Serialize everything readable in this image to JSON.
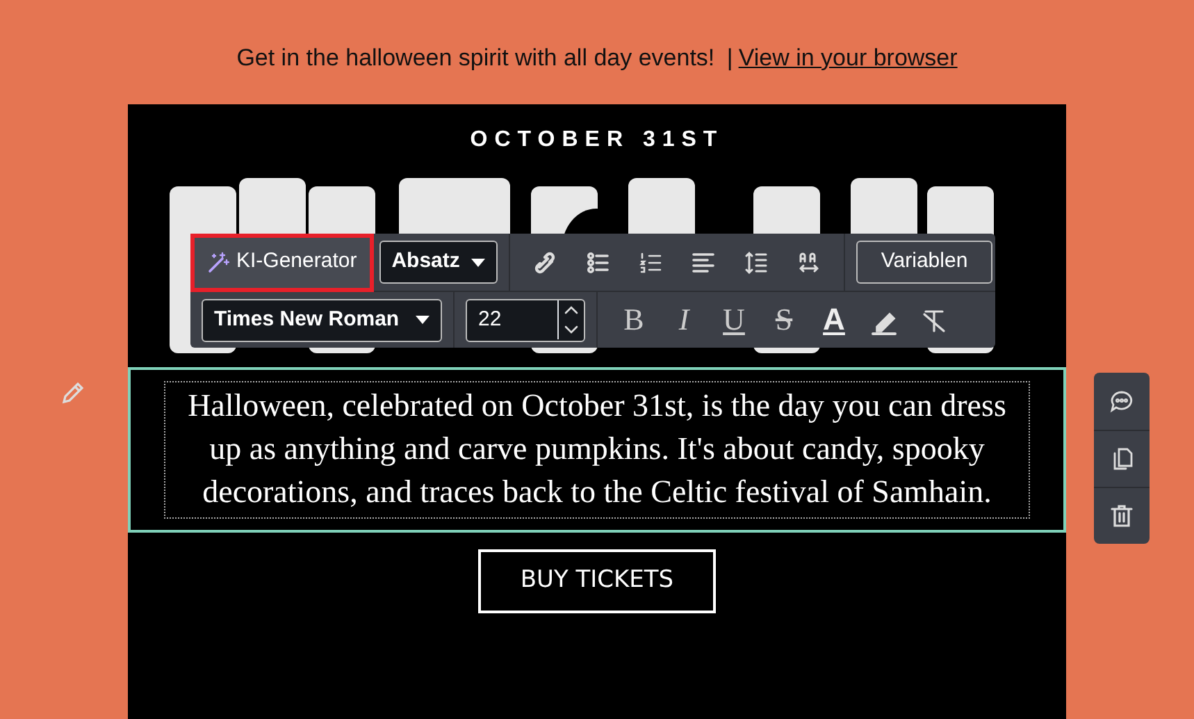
{
  "header": {
    "text": "Get in the halloween spirit with all day events!",
    "separator": "|",
    "link": "View in your browser"
  },
  "email": {
    "date": "OCTOBER 31ST",
    "paragraph": "Halloween, celebrated on October 31st, is the day you can dress up as anything and carve pumpkins. It's about candy, spooky decorations, and traces back to the Celtic festival of Samhain.",
    "button": "BUY TICKETS"
  },
  "toolbar": {
    "ai_button": {
      "label": "KI-Generator",
      "highlighted": true
    },
    "block_format": "Absatz",
    "variables_button": "Variablen",
    "font_family": "Times New Roman",
    "font_size": "22",
    "format_buttons": [
      {
        "kind": "bold",
        "label": "B"
      },
      {
        "kind": "italic",
        "label": "I"
      },
      {
        "kind": "underline",
        "label": "U"
      },
      {
        "kind": "strike",
        "label": "S"
      },
      {
        "kind": "text-color",
        "label": "A"
      },
      {
        "kind": "highlight"
      },
      {
        "kind": "clear-format"
      }
    ]
  }
}
